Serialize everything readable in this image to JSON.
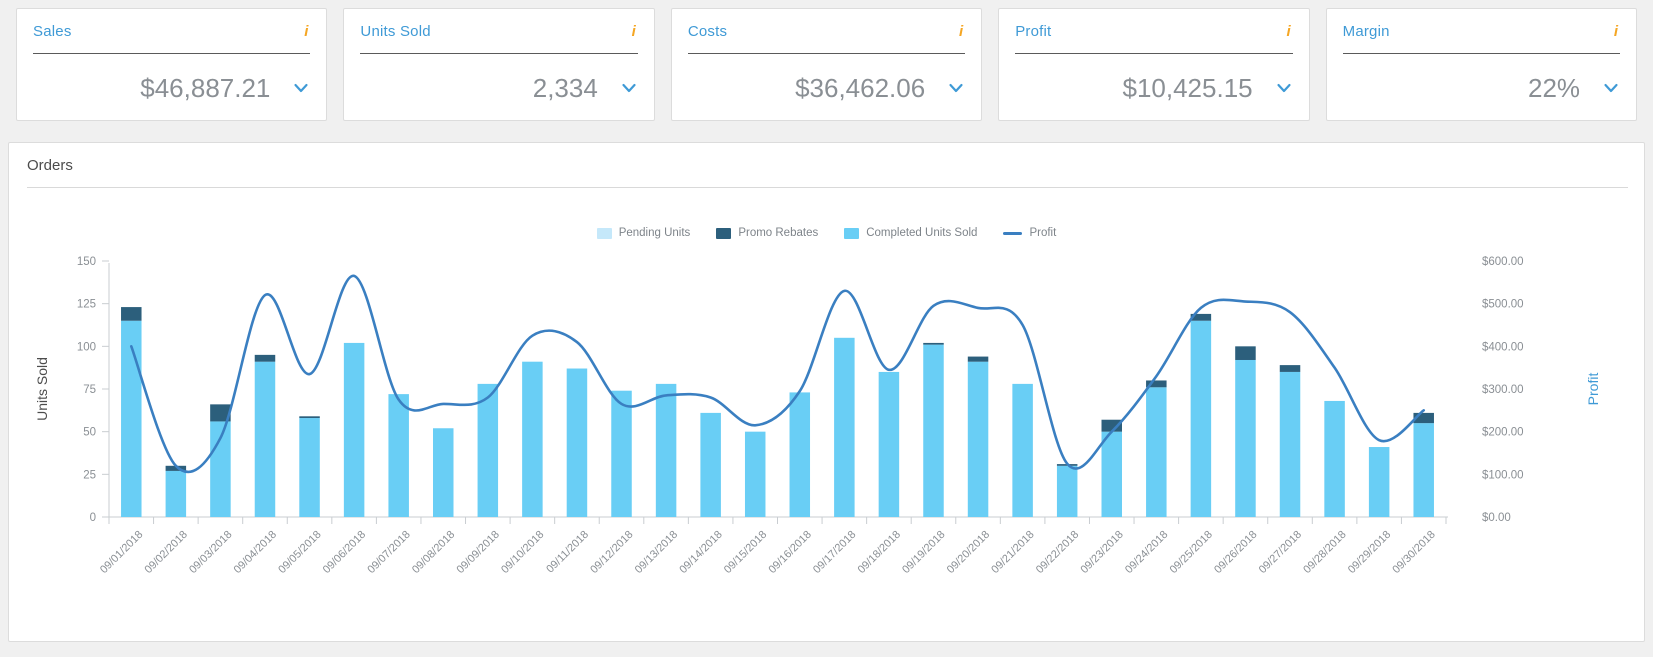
{
  "kpis": [
    {
      "title": "Sales",
      "value": "$46,887.21",
      "info_icon": "info-icon",
      "caret_icon": "chevron-down-icon"
    },
    {
      "title": "Units Sold",
      "value": "2,334",
      "info_icon": "info-icon",
      "caret_icon": "chevron-down-icon"
    },
    {
      "title": "Costs",
      "value": "$36,462.06",
      "info_icon": "info-icon",
      "caret_icon": "chevron-down-icon"
    },
    {
      "title": "Profit",
      "value": "$10,425.15",
      "info_icon": "info-icon",
      "caret_icon": "chevron-down-icon"
    },
    {
      "title": "Margin",
      "value": "22%",
      "info_icon": "info-icon",
      "caret_icon": "chevron-down-icon"
    }
  ],
  "panel": {
    "title": "Orders"
  },
  "colors": {
    "pending_units": "#c5e8fa",
    "promo_rebates": "#2c5f7c",
    "completed_units": "#69cef5",
    "profit_line": "#3a7fc1",
    "accent_blue": "#3f9ad6",
    "info_orange": "#f5a623",
    "value_gray": "#8a8f94"
  },
  "chart_data": {
    "type": "bar",
    "title": "Orders",
    "xlabel": "",
    "ylabel": "Units Sold",
    "y2label": "Profit",
    "ylim": [
      0,
      150
    ],
    "y2lim": [
      0,
      600
    ],
    "yticks": [
      "0",
      "25",
      "50",
      "75",
      "100",
      "125",
      "150"
    ],
    "y2ticks": [
      "$0.00",
      "$100.00",
      "$200.00",
      "$300.00",
      "$400.00",
      "$500.00",
      "$600.00"
    ],
    "grid": false,
    "legend_position": "top-center",
    "legend": [
      "Pending Units",
      "Promo Rebates",
      "Completed Units Sold",
      "Profit"
    ],
    "categories": [
      "09/01/2018",
      "09/02/2018",
      "09/03/2018",
      "09/04/2018",
      "09/05/2018",
      "09/06/2018",
      "09/07/2018",
      "09/08/2018",
      "09/09/2018",
      "09/10/2018",
      "09/11/2018",
      "09/12/2018",
      "09/13/2018",
      "09/14/2018",
      "09/15/2018",
      "09/16/2018",
      "09/17/2018",
      "09/18/2018",
      "09/19/2018",
      "09/20/2018",
      "09/21/2018",
      "09/22/2018",
      "09/23/2018",
      "09/24/2018",
      "09/25/2018",
      "09/26/2018",
      "09/27/2018",
      "09/28/2018",
      "09/29/2018",
      "09/30/2018"
    ],
    "series": [
      {
        "name": "Completed Units Sold",
        "color": "#69cef5",
        "values": [
          115,
          27,
          56,
          91,
          58,
          102,
          72,
          52,
          78,
          91,
          87,
          74,
          78,
          61,
          50,
          73,
          105,
          85,
          101,
          91,
          78,
          30,
          50,
          76,
          115,
          92,
          85,
          68,
          41,
          55
        ]
      },
      {
        "name": "Promo Rebates",
        "color": "#2c5f7c",
        "values": [
          8,
          3,
          10,
          4,
          1,
          0,
          0,
          0,
          0,
          0,
          0,
          0,
          0,
          0,
          0,
          0,
          0,
          0,
          1,
          3,
          0,
          1,
          7,
          4,
          4,
          8,
          4,
          0,
          0,
          6
        ]
      },
      {
        "name": "Pending Units",
        "color": "#c5e8fa",
        "values": [
          0,
          0,
          0,
          0,
          0,
          0,
          0,
          0,
          0,
          0,
          0,
          0,
          0,
          0,
          0,
          0,
          0,
          0,
          0,
          0,
          0,
          0,
          0,
          0,
          0,
          0,
          0,
          0,
          0,
          0
        ]
      },
      {
        "name": "Profit",
        "color": "#3a7fc1",
        "axis": "right",
        "values": [
          400,
          120,
          185,
          520,
          335,
          565,
          275,
          265,
          280,
          425,
          410,
          265,
          285,
          280,
          215,
          295,
          530,
          345,
          495,
          490,
          450,
          125,
          200,
          330,
          490,
          505,
          480,
          350,
          180,
          250
        ]
      }
    ]
  }
}
